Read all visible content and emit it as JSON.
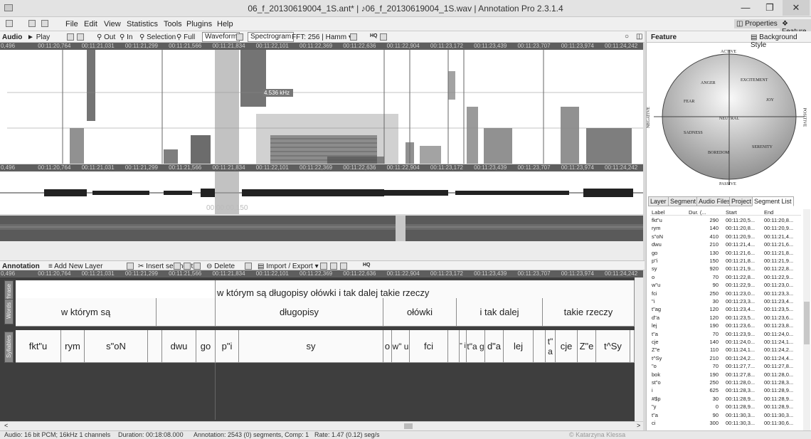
{
  "window": {
    "title": "06_f_20130619004_1S.ant* | ♪06_f_20130619004_1S.wav | Annotation Pro 2.3.1.4"
  },
  "menu": [
    "File",
    "Edit",
    "View",
    "Statistics",
    "Tools",
    "Plugins",
    "Help"
  ],
  "right_buttons": {
    "properties": "Properties",
    "feature": "Feature"
  },
  "audio_toolbar": {
    "label": "Audio",
    "play": "Play",
    "out": "Out",
    "in": "In",
    "selection": "Selection",
    "full": "Full",
    "waveform": "Waveform",
    "spectrogram": "Spectrogram",
    "fft": "FFT: 256 | Hamm",
    "hq": "HQ"
  },
  "timeline_ticks": [
    "0,496",
    "00:11:20,764",
    "00:11:21,031",
    "00:11:21,299",
    "00:11:21,566",
    "00:11:21,834",
    "00:11:22,101",
    "00:11:22,369",
    "00:11:22,636",
    "00:11:22,904",
    "00:11:23,172",
    "00:11:23,439",
    "00:11:23,707",
    "00:11:23,974",
    "00:11:24,242"
  ],
  "freq_label": "4.536 kHz",
  "cursor_time": "00:00:00,150",
  "annotation_toolbar": {
    "label": "Annotation",
    "add_layer": "Add New Layer",
    "insert": "Insert segment",
    "delete": "Delete",
    "import_export": "Import / Export",
    "hq": "HQ"
  },
  "tiers": [
    {
      "name": "Phrase",
      "segments": [
        "",
        "w którym są długopisy ołówki i tak dalej takie rzeczy"
      ]
    },
    {
      "name": "Words",
      "segments": [
        "w którym są",
        "",
        "długopisy",
        "ołówki",
        "i tak dalej",
        "takie rzeczy"
      ]
    },
    {
      "name": "Syllables",
      "segments": [
        "fkt\"u",
        "rym",
        "s\"oN",
        "",
        "dwu",
        "go",
        "p\"i",
        "sy",
        "o",
        "w\" u",
        "fci",
        "",
        "\" i",
        "t\"a g",
        "d\"a",
        "lej",
        "",
        "t\" a",
        "cje",
        "Z\"e",
        "t^Sy",
        ""
      ]
    }
  ],
  "status": {
    "audio": "Audio: 16 bit PCM; 16kHz 1 channels",
    "duration": "Duration: 00:18:08.000",
    "annotation": "Annotation: 2543 (0) segments, Comp: 1",
    "rate": "Rate: 1.47 (0.12) seg/s",
    "credit": "© Katarzyna Klessa"
  },
  "feature_panel": {
    "title": "Feature",
    "style": "Background Style",
    "axes": {
      "top": "ACTIVE",
      "bottom": "PASSIVE",
      "left": "NEGATIVE",
      "right": "POSITIVE"
    },
    "emotions": [
      "ANGER",
      "EXCITEMENT",
      "FEAR",
      "JOY",
      "NEUTRAL",
      "SADNESS",
      "SERENITY",
      "BOREDOM"
    ]
  },
  "tabs": [
    "Layer",
    "Segment",
    "Audio Files",
    "Project",
    "Segment List"
  ],
  "segment_list": {
    "headers": [
      "Label",
      "Dur. (...",
      "Start",
      "End"
    ],
    "rows": [
      [
        "fkt\"u",
        "290",
        "00:11:20,5...",
        "00:11:20,8..."
      ],
      [
        "rym",
        "140",
        "00:11:20,8...",
        "00:11:20,9..."
      ],
      [
        "s\"oN",
        "410",
        "00:11:20,9...",
        "00:11:21,4..."
      ],
      [
        "dwu",
        "210",
        "00:11:21,4...",
        "00:11:21,6..."
      ],
      [
        "go",
        "130",
        "00:11:21,6...",
        "00:11:21,8..."
      ],
      [
        "p\"i",
        "150",
        "00:11:21,8...",
        "00:11:21,9..."
      ],
      [
        "sy",
        "920",
        "00:11:21,9...",
        "00:11:22,8..."
      ],
      [
        "o",
        "70",
        "00:11:22,8...",
        "00:11:22,9..."
      ],
      [
        "w\"u",
        "90",
        "00:11:22,9...",
        "00:11:23,0..."
      ],
      [
        "fci",
        "250",
        "00:11:23,0...",
        "00:11:23,3..."
      ],
      [
        "\"i",
        "30",
        "00:11:23,3...",
        "00:11:23,4..."
      ],
      [
        "t\"ag",
        "120",
        "00:11:23,4...",
        "00:11:23,5..."
      ],
      [
        "d\"a",
        "120",
        "00:11:23,5...",
        "00:11:23,6..."
      ],
      [
        "lej",
        "190",
        "00:11:23,6...",
        "00:11:23,8..."
      ],
      [
        "t\"a",
        "70",
        "00:11:23,9...",
        "00:11:24,0..."
      ],
      [
        "cje",
        "140",
        "00:11:24,0...",
        "00:11:24,1..."
      ],
      [
        "Z\"e",
        "110",
        "00:11:24,1...",
        "00:11:24,2..."
      ],
      [
        "t^Sy",
        "210",
        "00:11:24,2...",
        "00:11:24,4..."
      ],
      [
        "\"o",
        "70",
        "00:11:27,7...",
        "00:11:27,8..."
      ],
      [
        "bok",
        "190",
        "00:11:27,8...",
        "00:11:28,0..."
      ],
      [
        "st\"o",
        "250",
        "00:11:28,0...",
        "00:11:28,3..."
      ],
      [
        "i",
        "625",
        "00:11:28,3...",
        "00:11:28,9..."
      ],
      [
        "#$p",
        "30",
        "00:11:28,9...",
        "00:11:28,9..."
      ],
      [
        "\"y",
        "0",
        "00:11:28,9...",
        "00:11:28,9..."
      ],
      [
        "t\"a",
        "90",
        "00:11:30,3...",
        "00:11:30,3..."
      ],
      [
        "ci",
        "300",
        "00:11:30,3...",
        "00:11:30,6..."
      ]
    ]
  }
}
